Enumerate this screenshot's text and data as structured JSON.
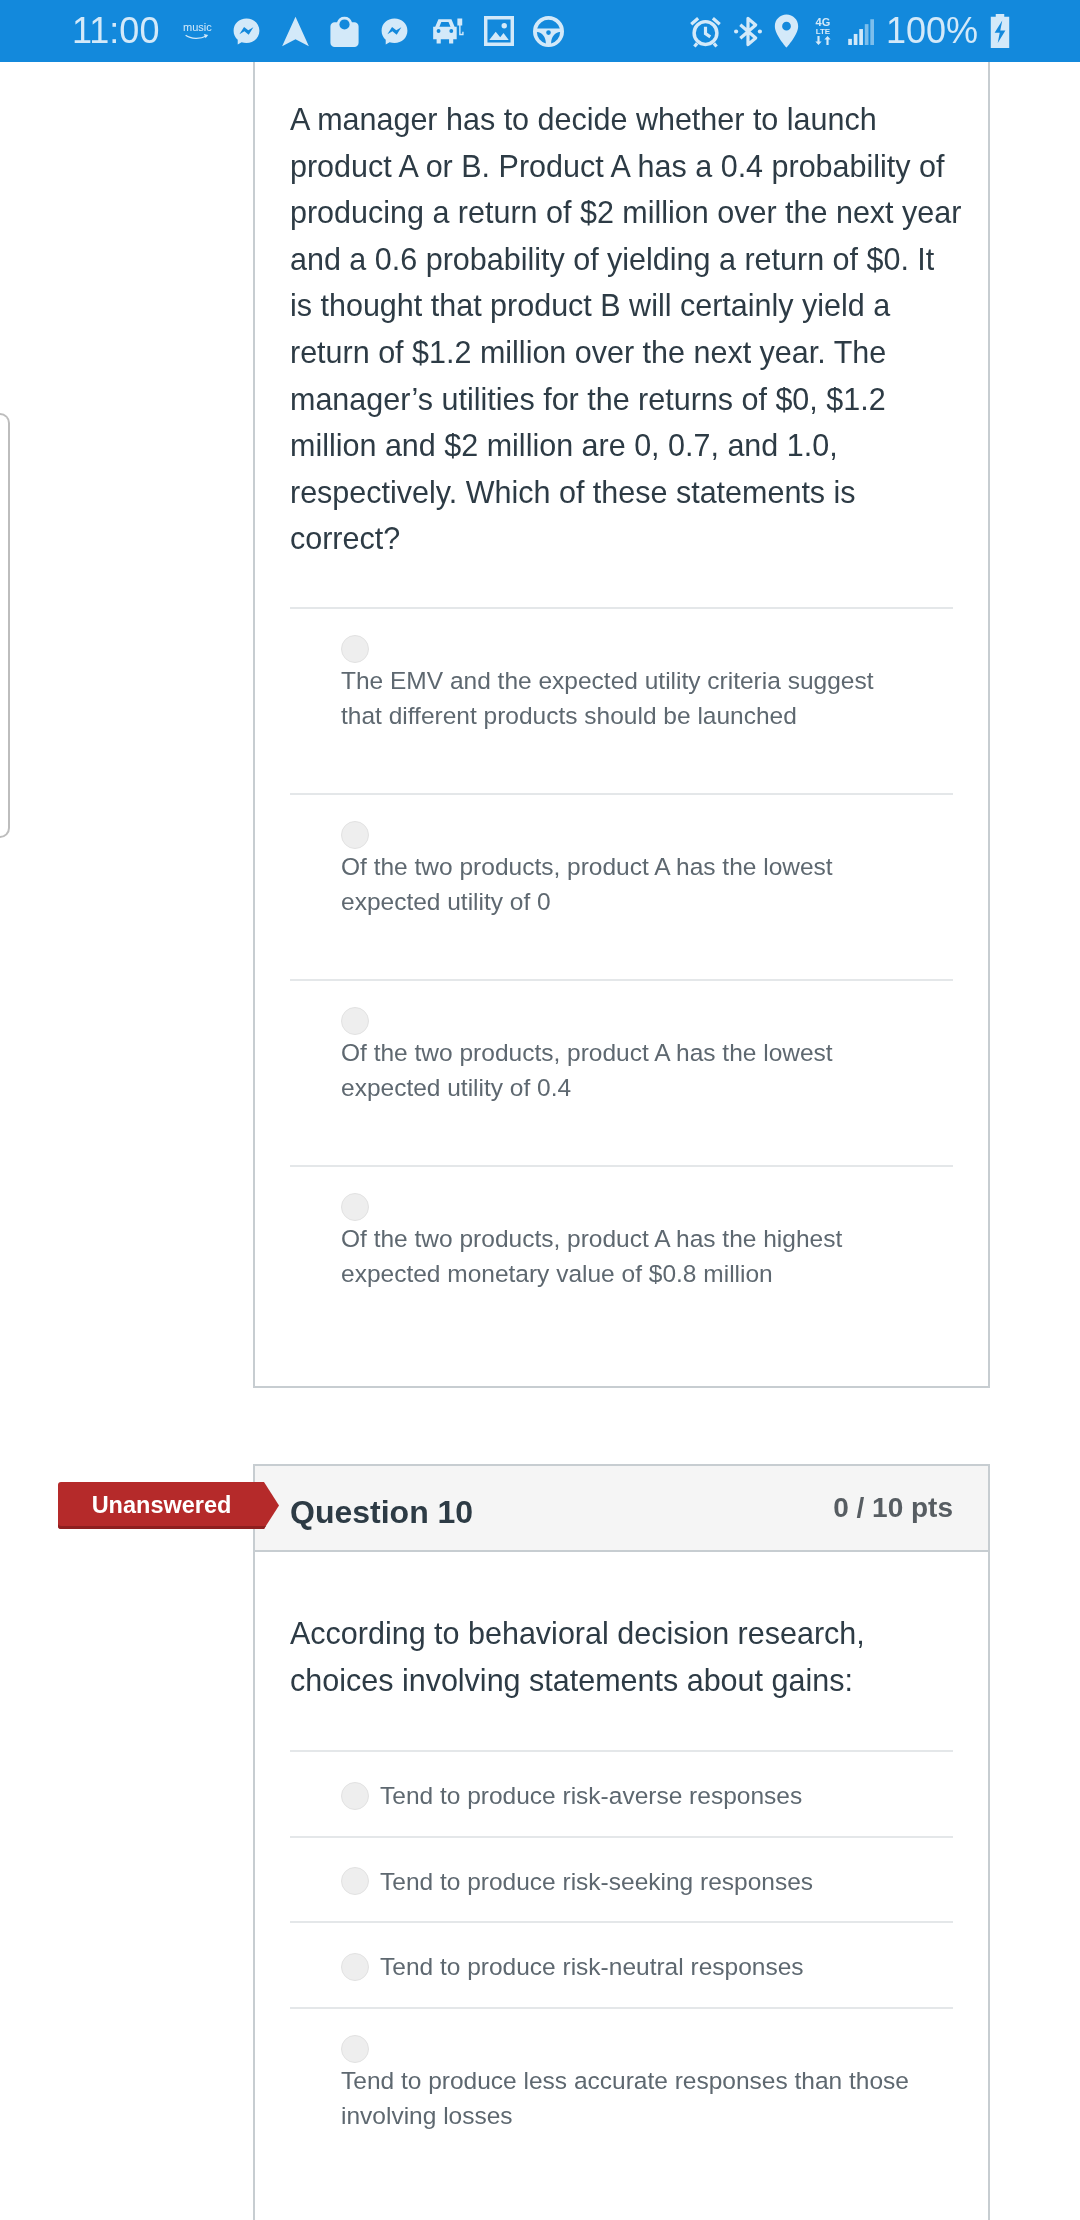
{
  "status_bar": {
    "time": "11:00",
    "music_label": "music",
    "network_type": "4G",
    "network_sub": "LTE",
    "battery": "100%"
  },
  "questions": [
    {
      "text": "A manager has to decide whether to launch product A or B. Product A has a 0.4 probability of producing a return of $2 million over the next year and a 0.6 probability of yielding a return of $0. It is thought that product B will certainly yield a return of $1.2 million over the next year. The manager’s utilities for the returns of $0, $1.2 million and $2 million are 0, 0.7, and 1.0, respectively. Which of these statements is correct?",
      "options": [
        {
          "label": "The EMV and the expected utility criteria suggest that different products should be launched",
          "selected": false
        },
        {
          "label": "Of the two products, product A has the lowest expected utility of 0",
          "selected": false
        },
        {
          "label": "Of the two products, product A has the lowest expected utility of 0.4",
          "selected": false
        },
        {
          "label": "Of the two products, product A has the highest expected monetary value of $0.8 million",
          "selected": false
        }
      ]
    },
    {
      "status": "Unanswered",
      "title": "Question 10",
      "points": "0 / 10 pts",
      "text": "According to behavioral decision research, choices involving statements about gains:",
      "options": [
        {
          "label": "Tend to produce risk-averse responses",
          "selected": false
        },
        {
          "label": "Tend to produce risk-seeking responses",
          "selected": false
        },
        {
          "label": "Tend to produce risk-neutral responses",
          "selected": false
        },
        {
          "label": "Tend to produce less accurate responses than those involving losses",
          "selected": false
        }
      ]
    }
  ]
}
